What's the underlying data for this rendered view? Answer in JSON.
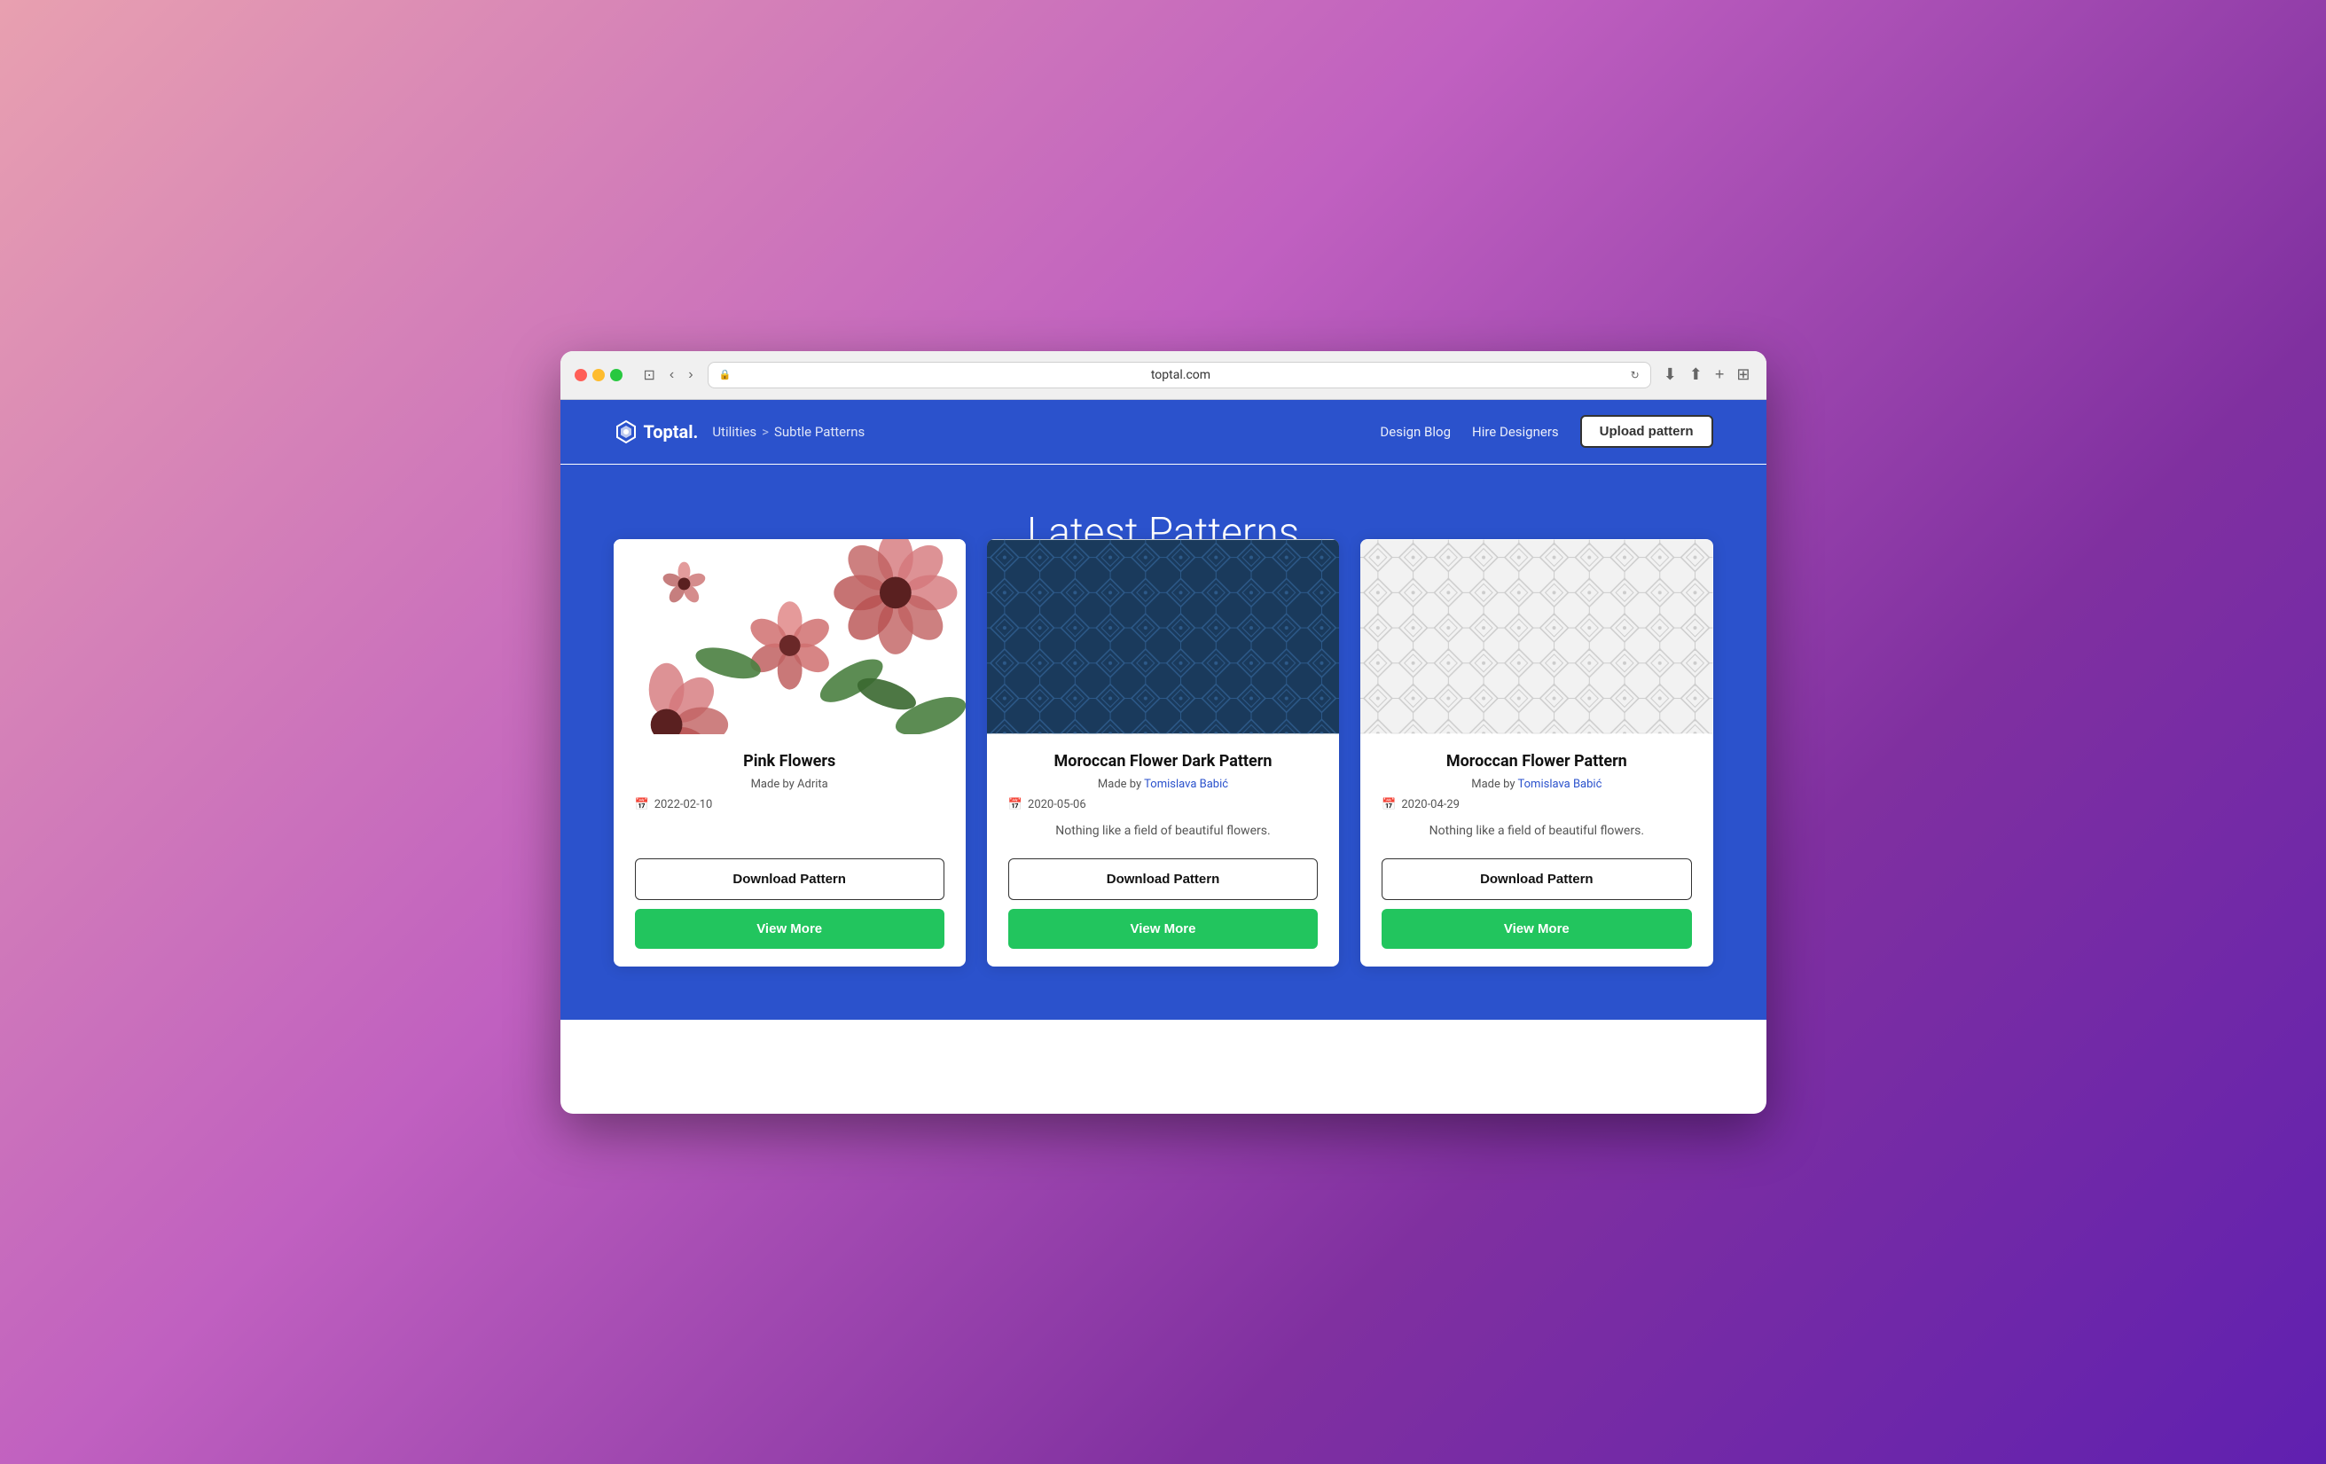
{
  "browser": {
    "url": "toptal.com",
    "traffic_lights": [
      "red",
      "yellow",
      "green"
    ]
  },
  "header": {
    "logo_text": "Toptal.",
    "breadcrumb_base": "Utilities",
    "breadcrumb_separator": ">",
    "breadcrumb_current": "Subtle Patterns",
    "nav": {
      "design_blog": "Design Blog",
      "hire_designers": "Hire Designers",
      "upload_pattern": "Upload pattern"
    }
  },
  "hero": {
    "title": "Latest Patterns"
  },
  "cards": [
    {
      "id": "pink-flowers",
      "title": "Pink Flowers",
      "author_label": "Made by Adrita",
      "author_link": null,
      "date": "2022-02-10",
      "description": "",
      "download_label": "Download Pattern",
      "view_more_label": "View More",
      "pattern_type": "flowers"
    },
    {
      "id": "moroccan-dark",
      "title": "Moroccan Flower Dark Pattern",
      "author_label": "Made by",
      "author_name": "Tomislava Babić",
      "author_link": true,
      "date": "2020-05-06",
      "description": "Nothing like a field of beautiful flowers.",
      "download_label": "Download Pattern",
      "view_more_label": "View More",
      "pattern_type": "moroccan-dark"
    },
    {
      "id": "moroccan-light",
      "title": "Moroccan Flower Pattern",
      "author_label": "Made by",
      "author_name": "Tomislava Babić",
      "author_link": true,
      "date": "2020-04-29",
      "description": "Nothing like a field of beautiful flowers.",
      "download_label": "Download Pattern",
      "view_more_label": "View More",
      "pattern_type": "moroccan-light"
    }
  ],
  "colors": {
    "primary_blue": "#2b52cc",
    "green": "#22c55e",
    "author_link": "#2b52cc"
  }
}
